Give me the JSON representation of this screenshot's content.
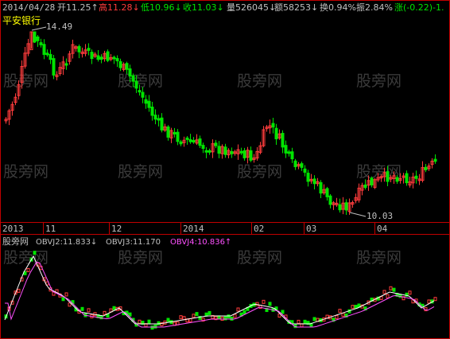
{
  "info_bar": {
    "date": "2014/04/28",
    "open": "开11.25↑",
    "high": "高11.28↓",
    "low": "低10.96↓",
    "close": "收11.03↓",
    "volume": "量526045↓",
    "amount": "额58253↓",
    "turnover": "换0.94%",
    "amplitude": "振2.84%",
    "change": "涨(-0.22)-1."
  },
  "stock_name": "平安银行",
  "watermark": "股旁网",
  "annotations": {
    "max_label": "14.49",
    "min_label": "10.03"
  },
  "time_axis": [
    "2013",
    "11",
    "12",
    "2014",
    "02",
    "03",
    "04"
  ],
  "indicator": {
    "name": "股旁网",
    "obvj2": "OBVJ2:11.833↓",
    "obvj3": "OBVJ3:11.170",
    "obvj4": "OBVJ4:10.836↑"
  },
  "colors": {
    "up": "#ff3c3c",
    "down": "#00e400",
    "yellow": "#ffff00",
    "magenta": "#ff50ff",
    "axis": "#c00000",
    "text": "#c0c0c0"
  }
}
